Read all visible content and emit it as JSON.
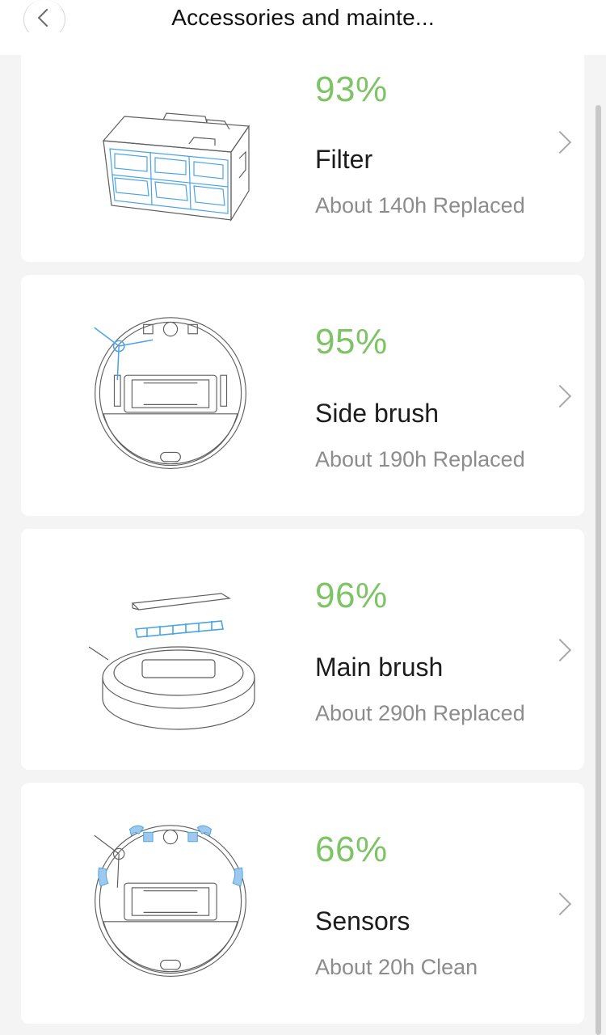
{
  "header": {
    "title": "Accessories and mainte..."
  },
  "items": [
    {
      "name": "Filter",
      "percent": "93%",
      "status": "About 140h Replaced",
      "icon": "filter-illustration"
    },
    {
      "name": "Side brush",
      "percent": "95%",
      "status": "About 190h Replaced",
      "icon": "side-brush-illustration"
    },
    {
      "name": "Main brush",
      "percent": "96%",
      "status": "About 290h Replaced",
      "icon": "main-brush-illustration"
    },
    {
      "name": "Sensors",
      "percent": "66%",
      "status": "About 20h Clean",
      "icon": "sensors-illustration"
    }
  ],
  "colors": {
    "percent": "#7ec466",
    "highlight": "#4aa3e8",
    "background": "#f4f4f4"
  }
}
